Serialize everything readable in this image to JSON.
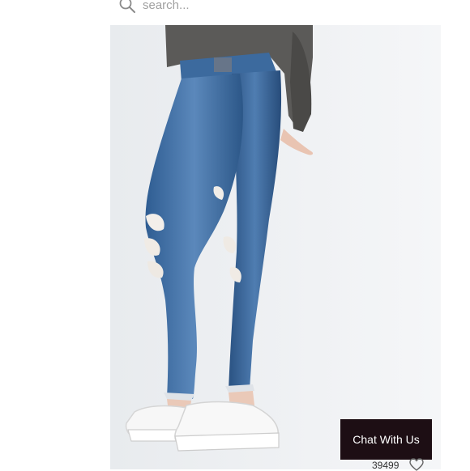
{
  "search": {
    "placeholder": "search..."
  },
  "chat": {
    "label": "Chat With Us"
  },
  "listing": {
    "like_count": "39499"
  },
  "colors": {
    "chat_bg": "#1d0e14",
    "denim": "#3f6ea6"
  },
  "icons": {
    "search": "search-icon",
    "like": "heart-icon"
  }
}
